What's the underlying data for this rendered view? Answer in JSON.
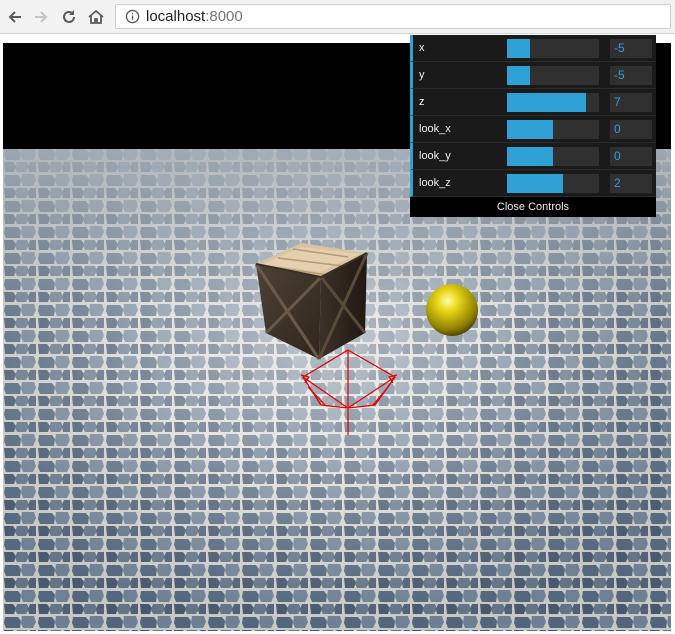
{
  "browser": {
    "url_host": "localhost",
    "url_port": ":8000"
  },
  "controls": {
    "rows": [
      {
        "label": "x",
        "value": "-5",
        "fill": 0.25
      },
      {
        "label": "y",
        "value": "-5",
        "fill": 0.25
      },
      {
        "label": "z",
        "value": "7",
        "fill": 0.86
      },
      {
        "label": "look_x",
        "value": "0",
        "fill": 0.5
      },
      {
        "label": "look_y",
        "value": "0",
        "fill": 0.5
      },
      {
        "label": "look_z",
        "value": "2",
        "fill": 0.61
      }
    ],
    "close_label": "Close Controls"
  },
  "colors": {
    "accent": "#2fa1d6",
    "panel_bg": "#1a1a1a",
    "sphere": "#d9c400",
    "helper_lines": "#e00000"
  }
}
